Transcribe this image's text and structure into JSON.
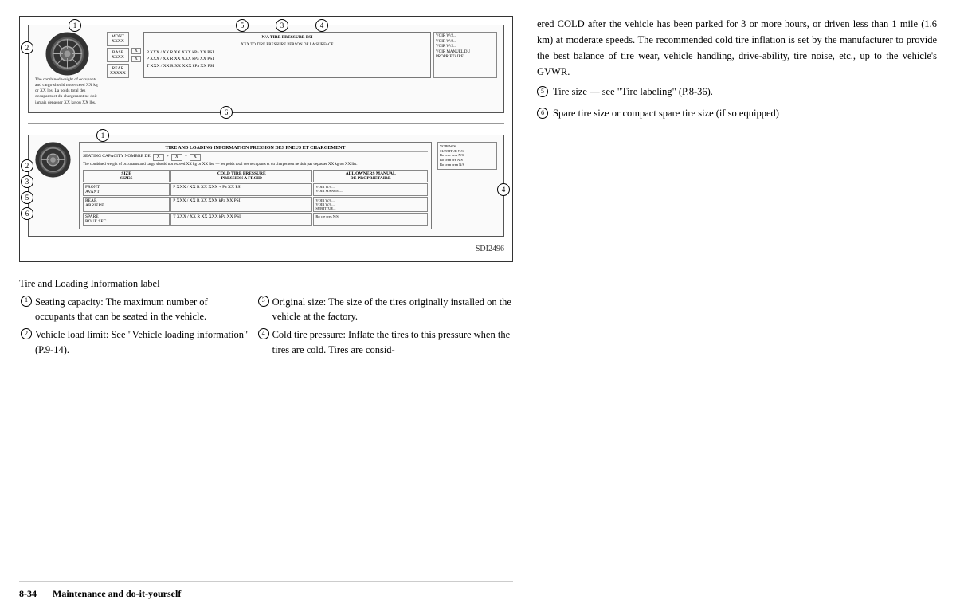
{
  "page": {
    "left_column": {
      "diagram_label": "Tire and Loading Information label",
      "items": [
        {
          "num": "①",
          "text": "Seating capacity: The maximum number of occupants that can be seated in the vehicle."
        },
        {
          "num": "②",
          "text": "Vehicle load limit: See \"Vehicle loading information\" (P.9-14)."
        },
        {
          "num": "③",
          "text": "Original size: The size of the tires originally installed on the vehicle at the factory."
        },
        {
          "num": "④",
          "text": "Cold tire pressure: Inflate the tires to this pressure when the tires are cold. Tires are consid-"
        }
      ]
    },
    "right_column": {
      "continued_text": "ered COLD after the vehicle has been parked for 3 or more hours, or driven less than 1 mile (1.6 km) at moderate speeds. The recommended cold tire inflation is set by the manufacturer to provide the best balance of tire wear, vehicle handling, drive-ability, tire noise, etc., up to the vehicle's GVWR.",
      "items": [
        {
          "num": "⑤",
          "text": "Tire size — see \"Tire labeling\" (P.8-36)."
        },
        {
          "num": "⑥",
          "text": "Spare tire size or compact spare tire size (if so equipped)"
        }
      ]
    },
    "footer": {
      "page_num": "8-34",
      "section": "Maintenance and do-it-yourself"
    },
    "diagram": {
      "sdi": "SDI2496",
      "upper_label_title": "N/A TIRE PRESSURE PSI",
      "upper_label_subtitle": "XXX TO TIRE PRESSURE PERSON DE LA SURFACE",
      "label_rows": [
        "P XXX / XX R XX    XXX kPa  XX PSI",
        "P XXX / XX R XX    XXX kPa  XX PSI",
        "T XXX / XX R XX    XXX kPa  XX PSI"
      ],
      "lower_label_title": "TIRE AND LOADING INFORMATION PRESSION DES PNEUS ET CHARGEMENT",
      "lower_label_rows": [
        "P XXX / XX R XX    XXX + Pa  XX PSI",
        "P XXX / XX R XX    XXX kPa  XX PSI",
        "T XXX / XX R XX    XXX kPa  XX PSI"
      ],
      "notes_text_upper": "The combined weight of occupants and cargo should not exceed XX kg or XX lbs. La poids total des occupants et du chargement ne doit jamais depasser XX kg ou XX lbs.",
      "notes_text_lower": "The combined weight of occupants and cargo should not exceed XX kg or XX lbs.\n— les poids total des occupants et du chargement ne doit pas depasser XX kg ou XX lbs.",
      "col_headers": [
        "SIZE SIZES",
        "COLD TIRE PRESSURE PRESSION A FROID",
        "ALL OWNERS MANUAL DE PROPRIETAIRE"
      ]
    }
  }
}
